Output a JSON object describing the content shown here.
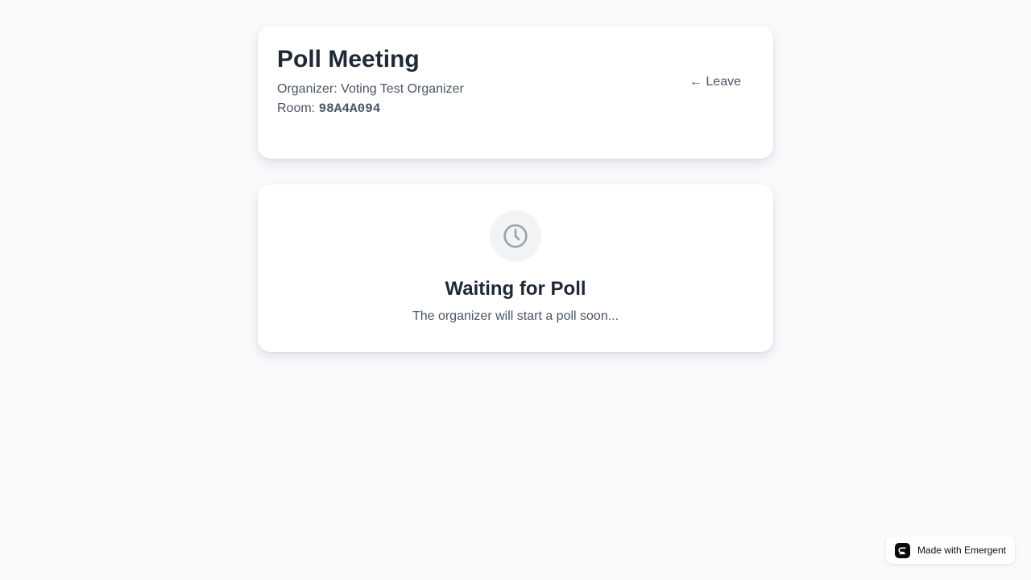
{
  "header": {
    "title": "Poll Meeting",
    "organizer_label": "Organizer:",
    "organizer_name": "Voting Test Organizer",
    "room_label": "Room:",
    "room_code": "98A4A094",
    "leave_label": "← Leave"
  },
  "status": {
    "icon": "clock-icon",
    "title": "Waiting for Poll",
    "subtitle": "The organizer will start a poll soon..."
  },
  "badge": {
    "icon": "emergent-logo-icon",
    "label": "Made with Emergent"
  },
  "colors": {
    "background": "#f8fafc",
    "card": "#ffffff",
    "text_primary": "#1f2937",
    "text_secondary": "#4b5563",
    "icon_gray": "#9ca3af"
  }
}
